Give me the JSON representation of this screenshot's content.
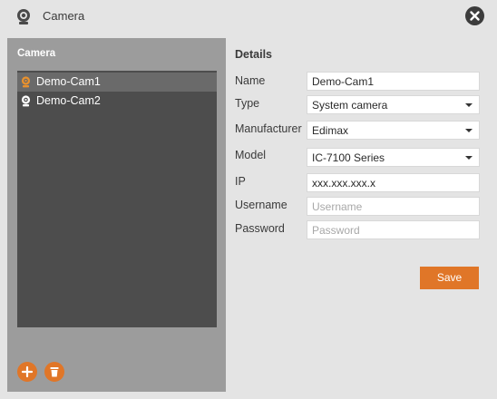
{
  "window": {
    "title": "Camera",
    "icon": "webcam-icon",
    "close_icon": "close-icon"
  },
  "camera_panel": {
    "header": "Camera",
    "items": [
      {
        "label": "Demo-Cam1",
        "selected": true,
        "icon": "webcam-icon",
        "icon_color": "#e8912e"
      },
      {
        "label": "Demo-Cam2",
        "selected": false,
        "icon": "webcam-icon",
        "icon_color": "#ffffff"
      }
    ],
    "add_button_icon": "plus-icon",
    "delete_button_icon": "trash-icon"
  },
  "details": {
    "header": "Details",
    "name": {
      "label": "Name",
      "value": "Demo-Cam1"
    },
    "type": {
      "label": "Type",
      "value": "System camera"
    },
    "manufacturer": {
      "label": "Manufacturer",
      "value": "Edimax"
    },
    "model": {
      "label": "Model",
      "value": "IC-7100 Series"
    },
    "ip": {
      "label": "IP",
      "value": "xxx.xxx.xxx.x"
    },
    "username": {
      "label": "Username",
      "value": "",
      "placeholder": "Username"
    },
    "password": {
      "label": "Password",
      "value": "",
      "placeholder": "Password"
    },
    "save_label": "Save"
  },
  "colors": {
    "accent": "#e07628",
    "background": "#e4e4e4",
    "panel": "#9c9c9c",
    "list": "#4d4d4d",
    "list_selected": "#6a6a6a"
  }
}
